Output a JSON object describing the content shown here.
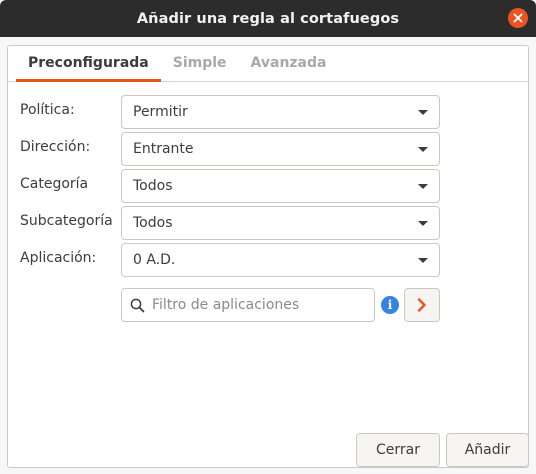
{
  "window": {
    "title": "Añadir una regla al cortafuegos",
    "close_icon": "close-icon"
  },
  "tabs": [
    {
      "label": "Preconfigurada",
      "active": true
    },
    {
      "label": "Simple",
      "active": false
    },
    {
      "label": "Avanzada",
      "active": false
    }
  ],
  "form": {
    "politica": {
      "label": "Política:",
      "value": "Permitir"
    },
    "direccion": {
      "label": "Dirección:",
      "value": "Entrante"
    },
    "categoria": {
      "label": "Categoría",
      "value": "Todos"
    },
    "subcategoria": {
      "label": "Subcategoría",
      "value": "Todos"
    },
    "aplicacion": {
      "label": "Aplicación:",
      "value": "0 A.D."
    }
  },
  "filter": {
    "placeholder": "Filtro de aplicaciones",
    "value": ""
  },
  "buttons": {
    "cancel": "Cerrar",
    "add": "Añadir"
  },
  "colors": {
    "accent": "#e95420",
    "info": "#3584e4",
    "titlebar": "#2c2c2c"
  }
}
